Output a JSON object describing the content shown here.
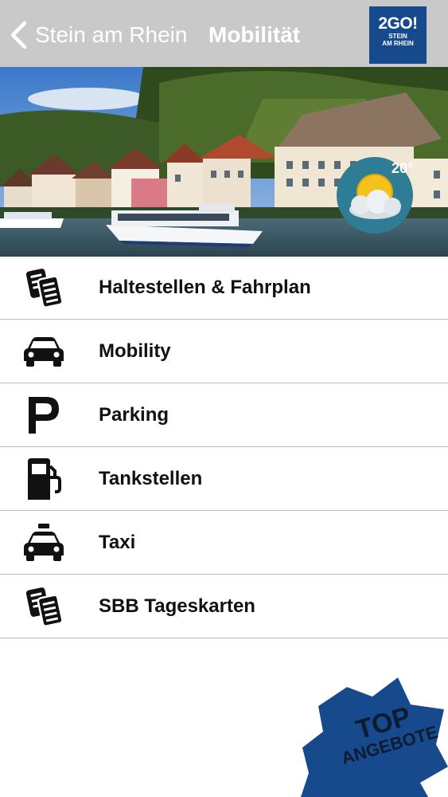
{
  "header": {
    "back_label": "Stein am Rhein",
    "title": "Mobilität",
    "logo": {
      "big": "2GO!",
      "line1": "STEIN",
      "line2": "AM RHEIN"
    }
  },
  "weather": {
    "temperature": "20°",
    "icon": "partly-cloudy-icon"
  },
  "menu": {
    "items": [
      {
        "label": "Haltestellen & Fahrplan",
        "icon": "tickets-icon"
      },
      {
        "label": "Mobility",
        "icon": "car-icon"
      },
      {
        "label": "Parking",
        "icon": "parking-icon"
      },
      {
        "label": "Tankstellen",
        "icon": "fuel-pump-icon"
      },
      {
        "label": "Taxi",
        "icon": "taxi-icon"
      },
      {
        "label": "SBB Tageskarten",
        "icon": "tickets-icon"
      }
    ]
  },
  "badge": {
    "line1": "TOP",
    "line2": "ANGEBOTE"
  },
  "colors": {
    "header": "#c9c9c9",
    "brand": "#164a8c",
    "weather": "#2f7c95"
  }
}
